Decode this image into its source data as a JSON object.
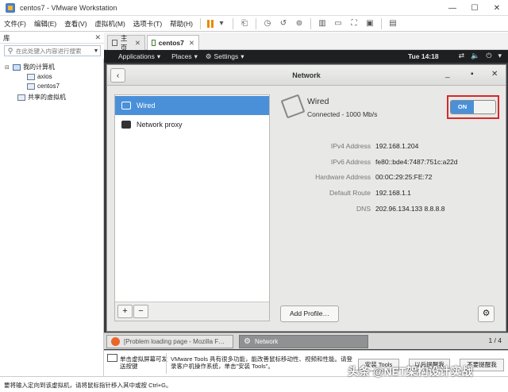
{
  "window": {
    "title": "centos7 - VMware Workstation"
  },
  "menu": [
    "文件(F)",
    "编辑(E)",
    "查看(V)",
    "虚拟机(M)",
    "选项卡(T)",
    "帮助(H)"
  ],
  "library": {
    "title": "库",
    "search_placeholder": "在此处键入内容进行搜索",
    "tree": {
      "root": "我的计算机",
      "vms": [
        "axios",
        "centos7"
      ],
      "shared": "共享的虚拟机"
    }
  },
  "tabs": [
    {
      "label": "主页"
    },
    {
      "label": "centos7"
    }
  ],
  "gnome": {
    "applications": "Applications",
    "places": "Places",
    "settings": "Settings",
    "clock": "Tue 14:18"
  },
  "settings_window": {
    "title": "Network",
    "list": [
      "Wired",
      "Network proxy"
    ],
    "add": "+",
    "remove": "−",
    "wired": {
      "title": "Wired",
      "status": "Connected - 1000 Mb/s",
      "switch": "ON",
      "details": [
        {
          "label": "IPv4 Address",
          "value": "192.168.1.204"
        },
        {
          "label": "IPv6 Address",
          "value": "fe80::bde4:7487:751c:a22d"
        },
        {
          "label": "Hardware Address",
          "value": "00:0C:29:25:FE:72"
        },
        {
          "label": "Default Route",
          "value": "192.168.1.1"
        },
        {
          "label": "DNS",
          "value": "202.96.134.133 8.8.8.8"
        }
      ]
    },
    "add_profile": "Add Profile…"
  },
  "taskbar": {
    "tasks": [
      "[Problem loading page - Mozilla F…",
      "Network"
    ],
    "pager": "1 / 4"
  },
  "vmtools": {
    "left_text": "单击虚拟屏幕可发送按键",
    "mid_text": "VMware Tools 具有很多功能，能改善鼠标移动性、视频和性能。请登录客户机操作系统，单击\"安装 Tools\"。",
    "buttons": [
      "安装 Tools",
      "以后提醒我",
      "不要提醒我"
    ]
  },
  "status": {
    "text": "要将输入定向到该虚拟机，请将鼠标指针移入其中或按 Ctrl+G。"
  },
  "watermark": "头条 @NET架构设计实战",
  "colors": {
    "accent": "#4a90d9",
    "highlight": "#d42a2a",
    "panel": "#1d1f20"
  }
}
